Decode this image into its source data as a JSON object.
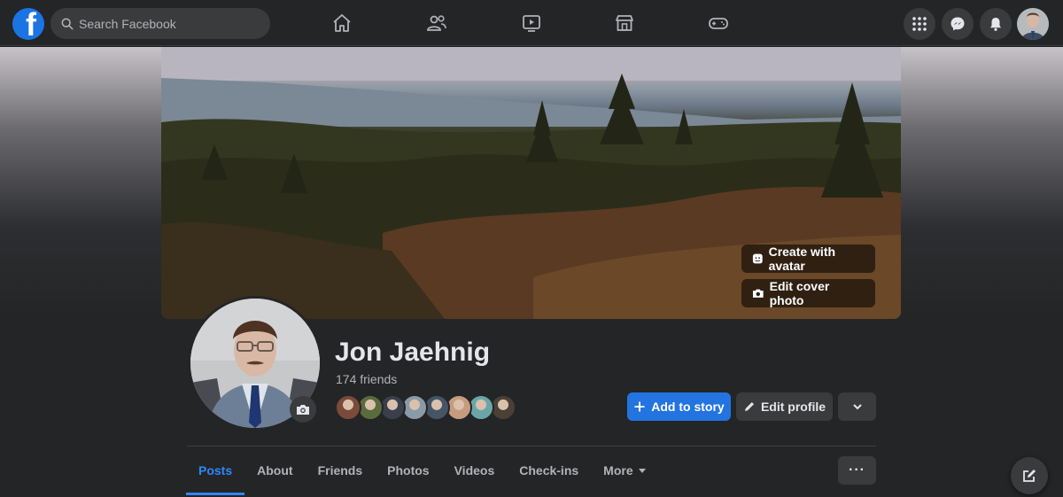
{
  "topbar": {
    "logo_letter": "f",
    "search_placeholder": "Search Facebook",
    "nav_icons": [
      "home-icon",
      "friends-icon",
      "watch-icon",
      "marketplace-icon",
      "gaming-icon"
    ],
    "right_icons": [
      "menu-grid-icon",
      "messenger-icon",
      "notifications-icon"
    ]
  },
  "cover": {
    "create_avatar_label": "Create with avatar",
    "edit_cover_label": "Edit cover photo"
  },
  "profile": {
    "name": "Jon Jaehnig",
    "friends": "174 friends",
    "friend_avatar_colors": [
      "#7a4b3a",
      "#5a6b3c",
      "#3b3f4a",
      "#8a9aa8",
      "#445566",
      "#c79b7d",
      "#6aa6a8",
      "#4a4036"
    ]
  },
  "actions": {
    "add_story": "Add to story",
    "edit_profile": "Edit profile"
  },
  "tabs": [
    {
      "label": "Posts",
      "active": true
    },
    {
      "label": "About"
    },
    {
      "label": "Friends"
    },
    {
      "label": "Photos"
    },
    {
      "label": "Videos"
    },
    {
      "label": "Check-ins"
    },
    {
      "label": "More"
    }
  ],
  "tabs_more_button": "···",
  "colors": {
    "accent": "#2374e1",
    "background": "#18191a",
    "surface": "#242526"
  }
}
